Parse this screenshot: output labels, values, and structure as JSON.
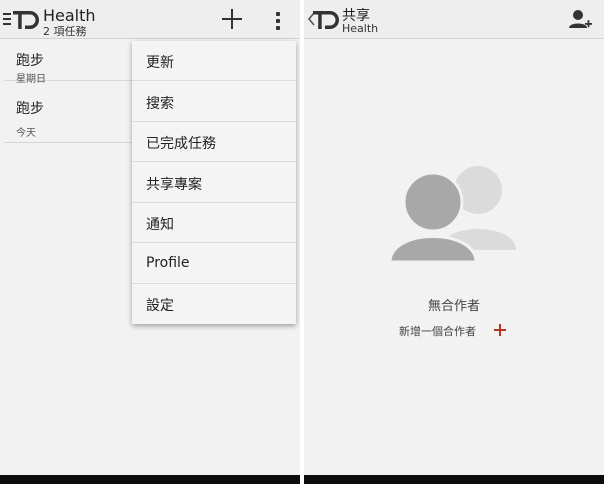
{
  "left": {
    "header": {
      "title": "Health",
      "subtitle": "2 項任務"
    },
    "tasks": [
      {
        "title": "跑步",
        "due": "星期日"
      },
      {
        "title": "跑步",
        "due": "今天"
      }
    ],
    "menu": {
      "items": [
        {
          "label": "更新"
        },
        {
          "label": "搜索"
        },
        {
          "label": "已完成任務"
        },
        {
          "label": "共享專案"
        },
        {
          "label": "通知"
        },
        {
          "label": "Profile"
        },
        {
          "label": "設定"
        }
      ]
    }
  },
  "right": {
    "header": {
      "title": "共享",
      "subtitle": "Health"
    },
    "empty": {
      "message": "無合作者",
      "add_label": "新增一個合作者"
    }
  },
  "colors": {
    "accent": "#b73524",
    "bar": "#efeeee",
    "background": "#f3f2f2"
  },
  "icons": [
    "menu-lines-icon",
    "app-logo-icon",
    "plus-icon",
    "overflow-menu-icon",
    "back-chevron-icon",
    "add-person-icon",
    "collaborators-icon"
  ]
}
